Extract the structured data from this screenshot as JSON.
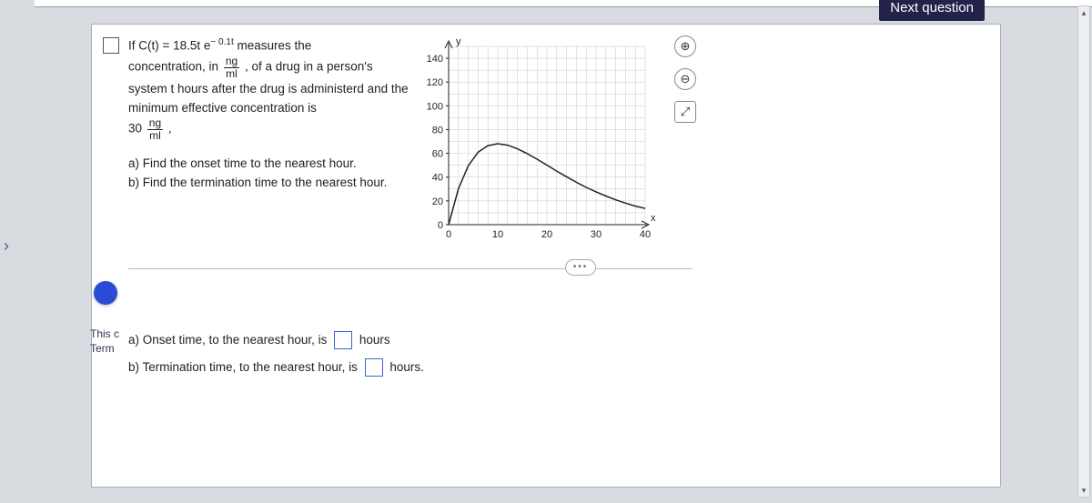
{
  "nav": {
    "prev_glyph": "›",
    "next_question_label": "Next question"
  },
  "problem": {
    "line1_pre": "If  C(t) = 18.5t e",
    "line1_exp": "− 0.1t",
    "line1_post": " measures the",
    "line2_pre": "concentration, in ",
    "frac1_num": "ng",
    "frac1_den": "ml",
    "line2_post": ", of a drug in a person's",
    "line3": "system t hours after the drug is administerd and the minimum effective concentration is",
    "min_conc_coef": "30",
    "frac2_num": "ng",
    "frac2_den": "ml",
    "min_conc_tail": " ,",
    "part_a": "a) Find the onset time to the nearest hour.",
    "part_b": "b) Find the termination time to the nearest hour."
  },
  "chart_data": {
    "type": "line",
    "xlabel": "x",
    "ylabel": "y",
    "xlim": [
      0,
      40
    ],
    "ylim": [
      0,
      150
    ],
    "y_ticks": [
      0,
      20,
      40,
      60,
      80,
      100,
      120,
      140
    ],
    "x_ticks": [
      0,
      10,
      20,
      30,
      40
    ],
    "x_tick_labels_faint": [
      "0",
      "10",
      "20",
      "30",
      "40"
    ],
    "series": [
      {
        "name": "C(t)=18.5t e^{-0.1t}",
        "x": [
          0,
          2,
          4,
          6,
          8,
          10,
          12,
          14,
          16,
          18,
          20,
          22,
          24,
          26,
          28,
          30,
          32,
          34,
          36,
          38,
          40
        ],
        "values": [
          0,
          30.3,
          49.6,
          61.0,
          66.5,
          68.1,
          66.9,
          63.8,
          59.8,
          55.1,
          50.1,
          45.1,
          40.3,
          35.7,
          31.4,
          27.6,
          24.1,
          20.9,
          18.1,
          15.6,
          13.6
        ]
      }
    ]
  },
  "tools": {
    "zoom_in": "⊕",
    "zoom_out": "⊖",
    "expand": "⤢"
  },
  "more_label": "•••",
  "side_tab": {
    "line1": "This c",
    "line2": "Term"
  },
  "answers": {
    "a_pre": "a) Onset time, to the nearest hour, is ",
    "a_post": " hours",
    "b_pre": "b) Termination time, to the nearest hour, is ",
    "b_post": " hours."
  },
  "scroll": {
    "up": "▴",
    "down": "▾"
  }
}
